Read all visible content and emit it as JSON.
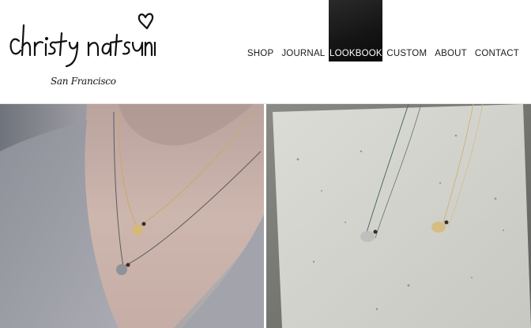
{
  "brand": {
    "name": "christy natsumi",
    "subtitle": "San Francisco"
  },
  "nav": {
    "items": [
      {
        "label": "SHOP"
      },
      {
        "label": "JOURNAL"
      },
      {
        "label": "LOOKBOOK",
        "active": true
      },
      {
        "label": "CUSTOM"
      },
      {
        "label": "ABOUT"
      },
      {
        "label": "CONTACT"
      }
    ]
  },
  "colors": {
    "nav_active_bg": "#1a1a1a",
    "text": "#1a1a1a",
    "background": "#ffffff"
  }
}
